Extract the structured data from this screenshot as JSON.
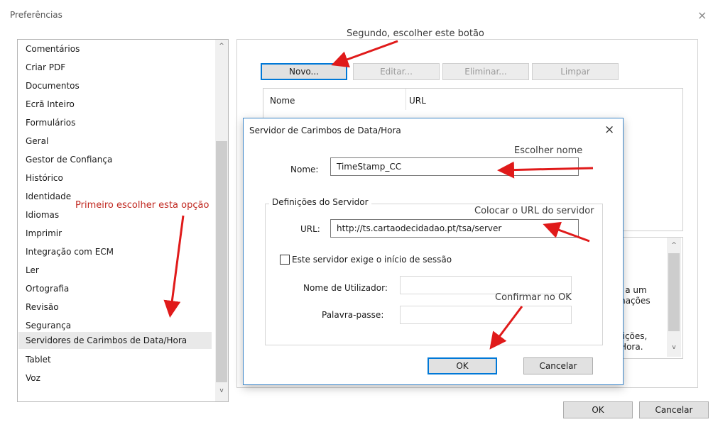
{
  "window": {
    "title": "Preferências",
    "close_glyph": "×"
  },
  "sidebar": {
    "items": [
      {
        "label": "Comentários"
      },
      {
        "label": "Criar PDF"
      },
      {
        "label": "Documentos"
      },
      {
        "label": "Ecrã Inteiro"
      },
      {
        "label": "Formulários"
      },
      {
        "label": "Geral"
      },
      {
        "label": "Gestor de Confiança"
      },
      {
        "label": "Histórico"
      },
      {
        "label": "Identidade"
      },
      {
        "label": "Idiomas"
      },
      {
        "label": "Imprimir"
      },
      {
        "label": "Integração com ECM"
      },
      {
        "label": "Ler"
      },
      {
        "label": "Ortografia"
      },
      {
        "label": "Revisão"
      },
      {
        "label": "Segurança"
      },
      {
        "label": "Servidores de Carimbos de Data/Hora"
      },
      {
        "label": "Tablet"
      },
      {
        "label": "Voz"
      }
    ],
    "selected": "Servidores de Carimbos de Data/Hora",
    "scroll_up": "^",
    "scroll_down": "v"
  },
  "toolbar": {
    "new_label": "Novo...",
    "edit_label": "Editar...",
    "delete_label": "Eliminar...",
    "clear_label": "Limpar"
  },
  "table": {
    "columns": [
      "Nome",
      "URL"
    ]
  },
  "right_panel": {
    "info_lines": [
      "a",
      "e a um",
      "mações"
    ],
    "info_lines2": [
      "nições,",
      "/Hora."
    ],
    "scroll_up": "^",
    "scroll_down": "v"
  },
  "dialog": {
    "title": "Servidor de Carimbos de Data/Hora",
    "close_glyph": "×",
    "name_label": "Nome:",
    "name_value": "TimeStamp_CC",
    "group_title": "Definições do Servidor",
    "url_label": "URL:",
    "url_value": "http://ts.cartaodecidadao.pt/tsa/server",
    "checkbox_label": "Este servidor exige o início de sessão",
    "checkbox_checked": false,
    "user_label": "Nome de Utilizador:",
    "user_value": "",
    "password_label": "Palavra-passe:",
    "password_value": "",
    "ok_label": "OK",
    "cancel_label": "Cancelar"
  },
  "footer": {
    "ok_label": "OK",
    "cancel_label": "Cancelar"
  },
  "annotations": {
    "second": "Segundo, escolher este botão",
    "first": "Primeiro escolher esta opção",
    "choose_name": "Escolher nome",
    "put_url": "Colocar o URL do servidor",
    "confirm_ok": "Confirmar no OK"
  },
  "colors": {
    "accent": "#0078d7",
    "annotation": "#c0271f",
    "arrow": "#e01a1a",
    "selection": "#e9e9e9"
  }
}
